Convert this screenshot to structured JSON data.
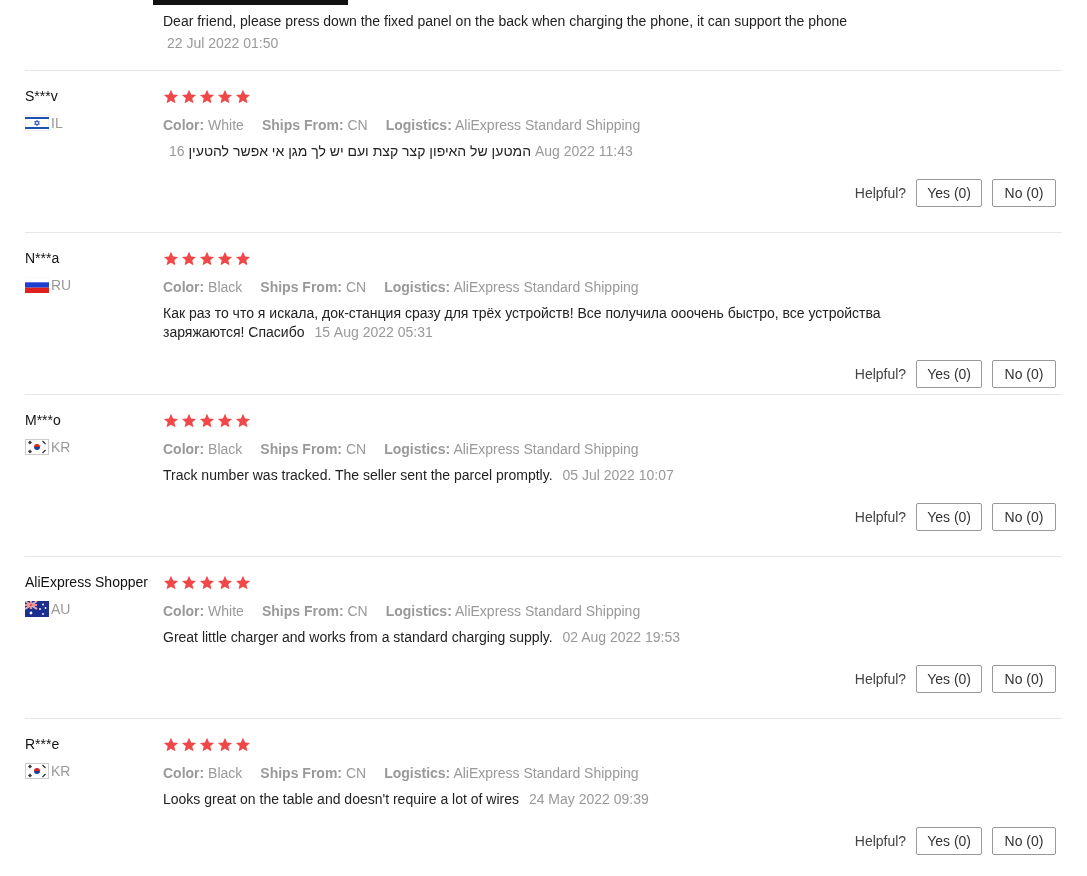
{
  "top_reply": {
    "text": "Dear friend, please press down the fixed panel on the back when charging the phone, it can support the phone",
    "date": "22 Jul 2022 01:50"
  },
  "reviews": [
    {
      "name": "S***v",
      "country": "IL",
      "kind": "israel",
      "stars": 5,
      "attributes": [
        {
          "label": "Color:",
          "value": "White"
        },
        {
          "label": "Ships From:",
          "value": "CN"
        },
        {
          "label": "Logistics:",
          "value": "AliExpress Standard Shipping"
        }
      ],
      "comment": "המטען של האיפון קצר קצת ועם יש לך מגן אי אפשר להטעין",
      "date": "16 Aug 2022 11:43",
      "helpful_label": "Helpful?",
      "yes_button": "Yes (0)",
      "no_button": "No (0)"
    },
    {
      "name": "N***a",
      "country": "RU",
      "kind": "russia",
      "stars": 5,
      "attributes": [
        {
          "label": "Color:",
          "value": "Black"
        },
        {
          "label": "Ships From:",
          "value": "CN"
        },
        {
          "label": "Logistics:",
          "value": "AliExpress Standard Shipping"
        }
      ],
      "comment": "Как раз то что я искала, док-станция сразу для трёх устройств! Все получила ооочень быстро, все устройства заряжаются! Спасибо",
      "date": "15 Aug 2022 05:31",
      "helpful_label": "Helpful?",
      "yes_button": "Yes (0)",
      "no_button": "No (0)"
    },
    {
      "name": "M***o",
      "country": "KR",
      "kind": "korea",
      "stars": 5,
      "attributes": [
        {
          "label": "Color:",
          "value": "Black"
        },
        {
          "label": "Ships From:",
          "value": "CN"
        },
        {
          "label": "Logistics:",
          "value": "AliExpress Standard Shipping"
        }
      ],
      "comment": "Track number was tracked. The seller sent the parcel promptly.",
      "date": "05 Jul 2022 10:07",
      "helpful_label": "Helpful?",
      "yes_button": "Yes (0)",
      "no_button": "No (0)"
    },
    {
      "name": "AliExpress Shopper",
      "country": "AU",
      "kind": "australia",
      "stars": 5,
      "attributes": [
        {
          "label": "Color:",
          "value": "White"
        },
        {
          "label": "Ships From:",
          "value": "CN"
        },
        {
          "label": "Logistics:",
          "value": "AliExpress Standard Shipping"
        }
      ],
      "comment": "Great little charger and works from a standard charging supply.",
      "date": "02 Aug 2022 19:53",
      "helpful_label": "Helpful?",
      "yes_button": "Yes (0)",
      "no_button": "No (0)"
    },
    {
      "name": "R***e",
      "country": "KR",
      "kind": "korea",
      "stars": 5,
      "attributes": [
        {
          "label": "Color:",
          "value": "Black"
        },
        {
          "label": "Ships From:",
          "value": "CN"
        },
        {
          "label": "Logistics:",
          "value": "AliExpress Standard Shipping"
        }
      ],
      "comment": "Looks great on the table and doesn't require a lot of wires",
      "date": "24 May 2022 09:39",
      "helpful_label": "Helpful?",
      "yes_button": "Yes (0)",
      "no_button": "No (0)"
    }
  ]
}
